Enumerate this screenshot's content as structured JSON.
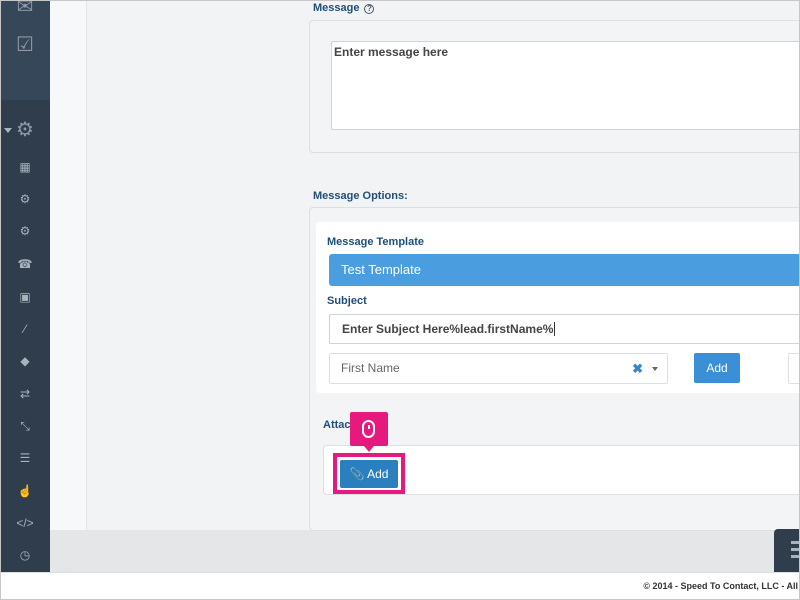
{
  "message_section": {
    "label": "Message",
    "help_icon": "?",
    "placeholder": "Enter message here"
  },
  "message_options": {
    "label": "Message Options:",
    "template_label": "Message Template",
    "template_value": "Test Template",
    "subject_label": "Subject",
    "subject_value": "Enter Subject Here%lead.firstName%",
    "field_select_value": "First Name",
    "clear_symbol": "✖",
    "add_label": "Add"
  },
  "attachments": {
    "label": "Attac",
    "add_button_label": "📎 Add"
  },
  "sidebar": {
    "icons": [
      "envelope-icon",
      "checklist-icon",
      "gear-icon",
      "building-icon",
      "settings-icon",
      "gears-icon",
      "phone-icon",
      "phone-square-icon",
      "magic-wand-icon",
      "tag-icon",
      "exchange-icon",
      "compress-icon",
      "sliders-icon",
      "thumbs-up-icon",
      "code-icon",
      "clock-icon"
    ]
  },
  "footer": {
    "copyright": "© 2014 - Speed To Contact, LLC - All"
  },
  "colors": {
    "sidebar": "#2f3d4c",
    "accent_blue": "#4a9ee0",
    "button_blue": "#3b8fd6",
    "highlight_pink": "#e6197f"
  }
}
